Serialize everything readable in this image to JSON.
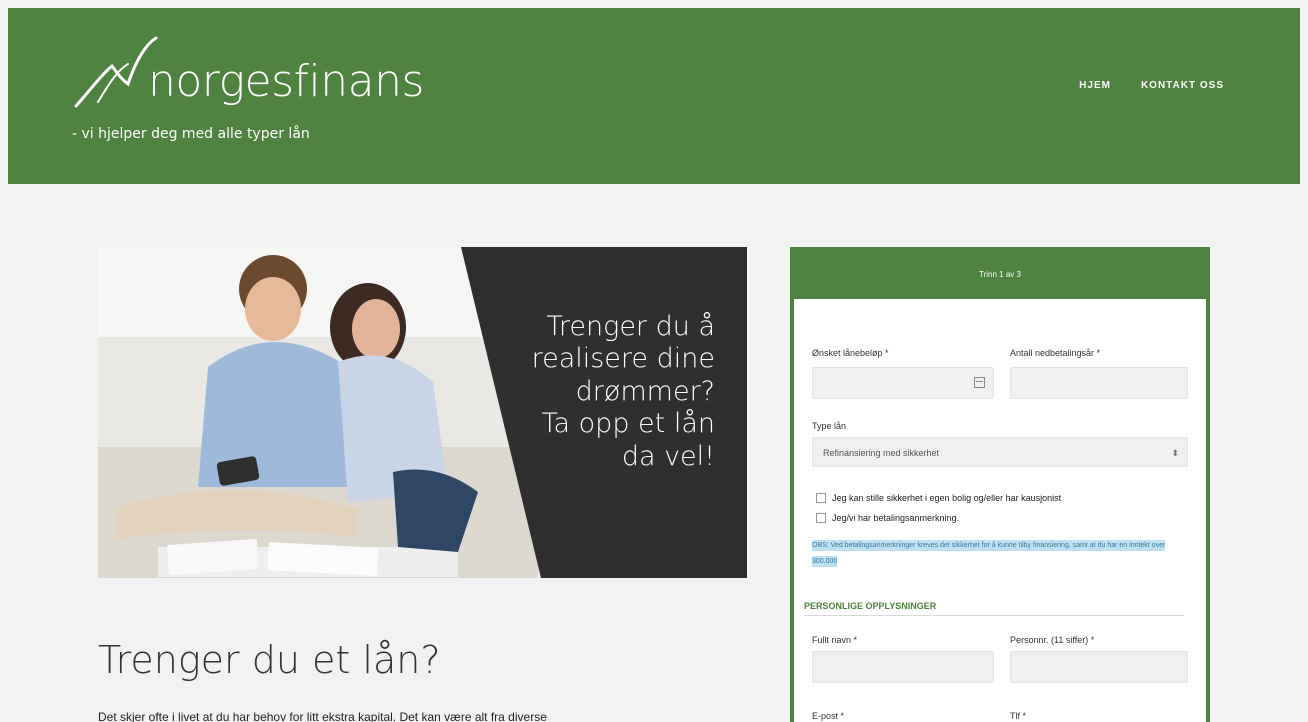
{
  "header": {
    "brand": "norgesfinans",
    "tagline": "- vi hjelper deg med alle typer lån",
    "nav": [
      {
        "label": "HJEM"
      },
      {
        "label": "KONTAKT OSS"
      }
    ]
  },
  "hero": {
    "headline": "Trenger du å\nrealisere dine\ndrømmer?\nTa opp et lån\nda vel!"
  },
  "main": {
    "title": "Trenger du et lån?",
    "intro": "Det skjer ofte i livet at du har behov for litt ekstra kapital. Det kan være alt fra diverse"
  },
  "form": {
    "step": "Trinn 1 av 3",
    "loan_amount_label": "Ønsket lånebeløp *",
    "years_label": "Antall nedbetalingsår *",
    "loan_type_label": "Type lån",
    "loan_type_value": "Refinansiering med sikkerhet",
    "checkbox_collateral": "Jeg kan stille sikkerhet i egen bolig og/eller har kausjonist",
    "checkbox_remarks": "Jeg/vi har betalingsanmerkning.",
    "note": "OBS: Ved betalingsanmerkninger kreves det sikkerhet for å kunne tilby finansiering, samt at du har en inntekt over 300.000",
    "section_personal": "PERSONLIGE OPPLYSNINGER",
    "full_name_label": "Fullt navn *",
    "person_number_label": "Personnr. (11 siffer) *",
    "email_label": "E-post *",
    "phone_label": "Tlf *"
  },
  "colors": {
    "brand_green": "#4f8140",
    "note_highlight": "#bfe0f3"
  }
}
